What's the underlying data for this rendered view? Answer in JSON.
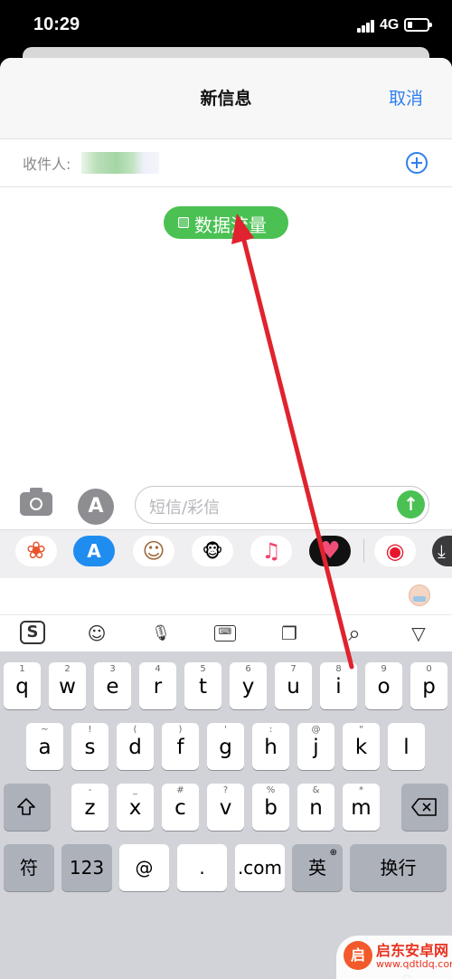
{
  "status_bar": {
    "time": "10:29",
    "network": "4G",
    "battery_level": 0.25
  },
  "nav": {
    "title": "新信息",
    "cancel_label": "取消"
  },
  "recipient": {
    "label": "收件人:"
  },
  "message_chip": {
    "label": "数据流量"
  },
  "composer": {
    "placeholder": "短信/彩信",
    "camera_icon": "camera-icon",
    "appstore_icon": "appstore-icon",
    "send_icon": "arrow-up-icon",
    "send_color": "#4ac152"
  },
  "app_strip": {
    "apps": [
      {
        "name": "photos",
        "icon": "photos-icon",
        "glyph": "❀"
      },
      {
        "name": "app-store",
        "icon": "appstore-icon",
        "glyph": "A"
      },
      {
        "name": "memoji",
        "icon": "memoji-icon",
        "glyph": "☺"
      },
      {
        "name": "animoji",
        "icon": "monkey-icon",
        "glyph": "🐵"
      },
      {
        "name": "music",
        "icon": "music-icon",
        "glyph": "♫"
      },
      {
        "name": "digital-touch",
        "icon": "heart-icon",
        "glyph": "♥"
      },
      {
        "name": "weibo",
        "icon": "weibo-icon",
        "glyph": "◉"
      },
      {
        "name": "more",
        "icon": "more-app-icon",
        "glyph": "⤓"
      }
    ]
  },
  "ime_toolbar": {
    "sogou_label": "S",
    "emoji_glyph": "☺",
    "mic_glyph": "🎙",
    "keyboard_glyph": "⌨",
    "clipboard_glyph": "❐",
    "search_glyph": "⌕",
    "collapse_glyph": "▽"
  },
  "keyboard": {
    "row1": [
      {
        "hint": "1",
        "key": "q"
      },
      {
        "hint": "2",
        "key": "w"
      },
      {
        "hint": "3",
        "key": "e"
      },
      {
        "hint": "4",
        "key": "r"
      },
      {
        "hint": "5",
        "key": "t"
      },
      {
        "hint": "6",
        "key": "y"
      },
      {
        "hint": "7",
        "key": "u"
      },
      {
        "hint": "8",
        "key": "i"
      },
      {
        "hint": "9",
        "key": "o"
      },
      {
        "hint": "0",
        "key": "p"
      }
    ],
    "row2": [
      {
        "hint": "~",
        "key": "a"
      },
      {
        "hint": "!",
        "key": "s"
      },
      {
        "hint": "(",
        "key": "d"
      },
      {
        "hint": ")",
        "key": "f"
      },
      {
        "hint": "'",
        "key": "g"
      },
      {
        "hint": ":",
        "key": "h"
      },
      {
        "hint": "@",
        "key": "j"
      },
      {
        "hint": "\"",
        "key": "k"
      },
      {
        "hint": "",
        "key": "l"
      }
    ],
    "row3": [
      {
        "hint": "-",
        "key": "z"
      },
      {
        "hint": "_",
        "key": "x"
      },
      {
        "hint": "#",
        "key": "c"
      },
      {
        "hint": "?",
        "key": "v"
      },
      {
        "hint": "%",
        "key": "b"
      },
      {
        "hint": "&",
        "key": "n"
      },
      {
        "hint": "*",
        "key": "m"
      }
    ],
    "fu": "符",
    "num": "123",
    "at": "@",
    "dot": ".",
    "dotcom": ".com",
    "lang": "英",
    "return": "换行"
  },
  "watermark": {
    "title": "启东安卓网",
    "url": "www.qdtldq.com",
    "logo": "启"
  },
  "annotation_color": "#e0232e"
}
